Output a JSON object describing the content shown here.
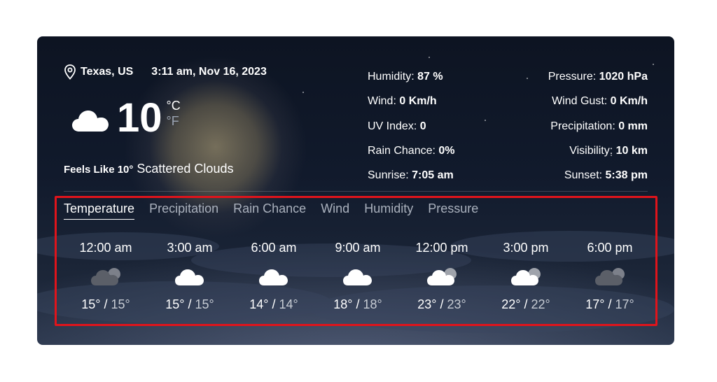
{
  "location": {
    "city": "Texas, US",
    "datetime": "3:11 am, Nov 16, 2023"
  },
  "current": {
    "temperature": "10",
    "unit_c": "°C",
    "unit_f": "°F",
    "icon": "cloud-icon",
    "feels_like": "Feels Like 10°",
    "description": "Scattered Clouds"
  },
  "stats_left": [
    {
      "label": "Humidity: ",
      "value": "87 %"
    },
    {
      "label": "Wind: ",
      "value": "0 Km/h"
    },
    {
      "label": "UV Index: ",
      "value": "0"
    },
    {
      "label": "Rain Chance: ",
      "value": "0%"
    },
    {
      "label": "Sunrise: ",
      "value": "7:05 am"
    }
  ],
  "stats_right": [
    {
      "label": "Pressure: ",
      "value": "1020 hPa"
    },
    {
      "label": "Wind Gust: ",
      "value": "0 Km/h"
    },
    {
      "label": "Precipitation: ",
      "value": "0 mm"
    },
    {
      "label": "Visibility: ",
      "value": "10 km"
    },
    {
      "label": "Sunset: ",
      "value": "5:38 pm"
    }
  ],
  "tabs": [
    {
      "label": "Temperature",
      "active": true
    },
    {
      "label": "Precipitation"
    },
    {
      "label": "Rain Chance"
    },
    {
      "label": "Wind"
    },
    {
      "label": "Humidity"
    },
    {
      "label": "Pressure"
    }
  ],
  "hourly": [
    {
      "time": "12:00 am",
      "lo": "15°",
      "sep": " / ",
      "hi": "15°",
      "icon": "dark-cloud-icon"
    },
    {
      "time": "3:00 am",
      "lo": "15°",
      "sep": " / ",
      "hi": "15°",
      "icon": "cloud-icon"
    },
    {
      "time": "6:00 am",
      "lo": "14°",
      "sep": " / ",
      "hi": "14°",
      "icon": "cloud-icon"
    },
    {
      "time": "9:00 am",
      "lo": "18°",
      "sep": " / ",
      "hi": "18°",
      "icon": "cloud-icon"
    },
    {
      "time": "12:00 pm",
      "lo": "23°",
      "sep": " / ",
      "hi": "23°",
      "icon": "scattered-clouds-icon"
    },
    {
      "time": "3:00 pm",
      "lo": "22°",
      "sep": " / ",
      "hi": "22°",
      "icon": "scattered-clouds-icon"
    },
    {
      "time": "6:00 pm",
      "lo": "17°",
      "sep": " / ",
      "hi": "17°",
      "icon": "dark-cloud-icon"
    }
  ],
  "colors": {
    "highlight": "#e0141b",
    "inactive_tab": "#aab1bd",
    "unit_f": "#9aa3b2"
  }
}
